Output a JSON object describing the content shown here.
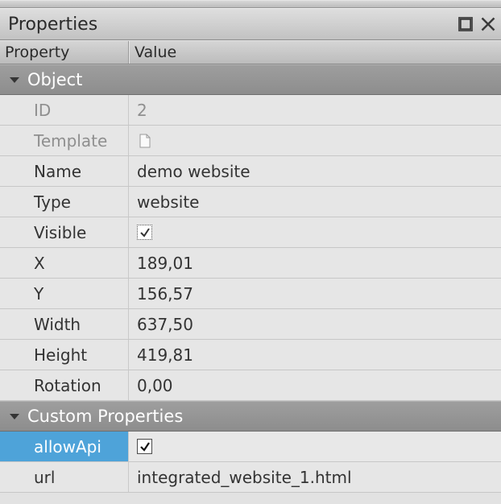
{
  "panel": {
    "title": "Properties"
  },
  "columns": {
    "property": "Property",
    "value": "Value"
  },
  "groups": {
    "object": {
      "label": "Object"
    },
    "custom": {
      "label": "Custom Properties"
    }
  },
  "object": {
    "id": {
      "label": "ID",
      "value": "2"
    },
    "template": {
      "label": "Template",
      "value": ""
    },
    "name": {
      "label": "Name",
      "value": "demo website"
    },
    "type": {
      "label": "Type",
      "value": "website"
    },
    "visible": {
      "label": "Visible",
      "checked": true
    },
    "x": {
      "label": "X",
      "value": "189,01"
    },
    "y": {
      "label": "Y",
      "value": "156,57"
    },
    "width": {
      "label": "Width",
      "value": "637,50"
    },
    "height": {
      "label": "Height",
      "value": "419,81"
    },
    "rotation": {
      "label": "Rotation",
      "value": "0,00"
    }
  },
  "custom": {
    "allowApi": {
      "label": "allowApi",
      "checked": true
    },
    "url": {
      "label": "url",
      "value": "integrated_website_1.html"
    }
  },
  "selected_property": "allowApi"
}
